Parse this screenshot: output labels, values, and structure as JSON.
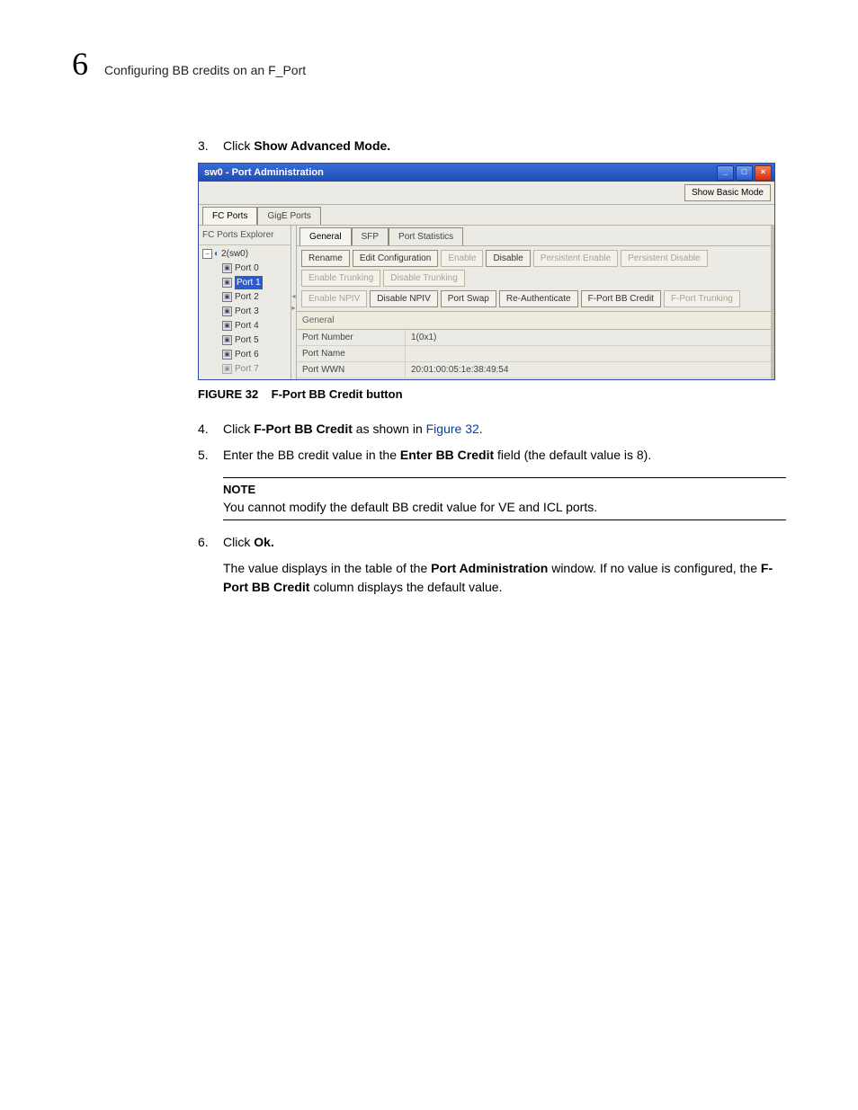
{
  "header": {
    "chapter_number": "6",
    "chapter_title": "Configuring BB credits on an F_Port"
  },
  "steps": {
    "s3_num": "3.",
    "s3_a": "Click ",
    "s3_b": "Show Advanced Mode.",
    "s4_num": "4.",
    "s4_a": "Click ",
    "s4_b": "F-Port BB Credit",
    "s4_c": " as shown in ",
    "s4_d": "Figure 32",
    "s4_e": ".",
    "s5_num": "5.",
    "s5_a": "Enter the BB credit value in the ",
    "s5_b": "Enter BB Credit",
    "s5_c": " field (the default value is 8).",
    "s6_num": "6.",
    "s6_a": "Click ",
    "s6_b": "Ok.",
    "s6_body_a": "The value displays in the table of the ",
    "s6_body_b": "Port Administration",
    "s6_body_c": " window. If no value is configured, the ",
    "s6_body_d": "F-Port BB Credit",
    "s6_body_e": " column displays the default value."
  },
  "figure": {
    "label_a": "FIGURE 32",
    "label_b": "F-Port BB Credit button"
  },
  "note": {
    "label": "NOTE",
    "text": "You cannot modify the default BB credit value for VE and ICL ports."
  },
  "app": {
    "title": "sw0 - Port Administration",
    "show_basic": "Show Basic Mode",
    "outer_tabs": {
      "fc": "FC Ports",
      "gige": "GigE Ports"
    },
    "explorer_header": "FC Ports Explorer",
    "tree_root": "2(sw0)",
    "ports": {
      "p0": "Port 0",
      "p1": "Port 1",
      "p2": "Port 2",
      "p3": "Port 3",
      "p4": "Port 4",
      "p5": "Port 5",
      "p6": "Port 6",
      "p7": "Port 7"
    },
    "inner_tabs": {
      "general": "General",
      "sfp": "SFP",
      "stats": "Port Statistics"
    },
    "buttons": {
      "rename": "Rename",
      "edit_cfg": "Edit Configuration",
      "enable": "Enable",
      "disable": "Disable",
      "p_enable": "Persistent Enable",
      "p_disable": "Persistent Disable",
      "en_trunk": "Enable Trunking",
      "dis_trunk": "Disable Trunking",
      "en_npiv": "Enable NPIV",
      "dis_npiv": "Disable NPIV",
      "port_swap": "Port Swap",
      "reauth": "Re-Authenticate",
      "fport_bb": "F-Port BB Credit",
      "fport_trunk": "F-Port Trunking"
    },
    "section_general": "General",
    "kv": {
      "port_number_k": "Port Number",
      "port_number_v": "1(0x1)",
      "port_name_k": "Port Name",
      "port_name_v": "",
      "port_wwn_k": "Port WWN",
      "port_wwn_v": "20:01:00:05:1e:38:49:54"
    }
  }
}
